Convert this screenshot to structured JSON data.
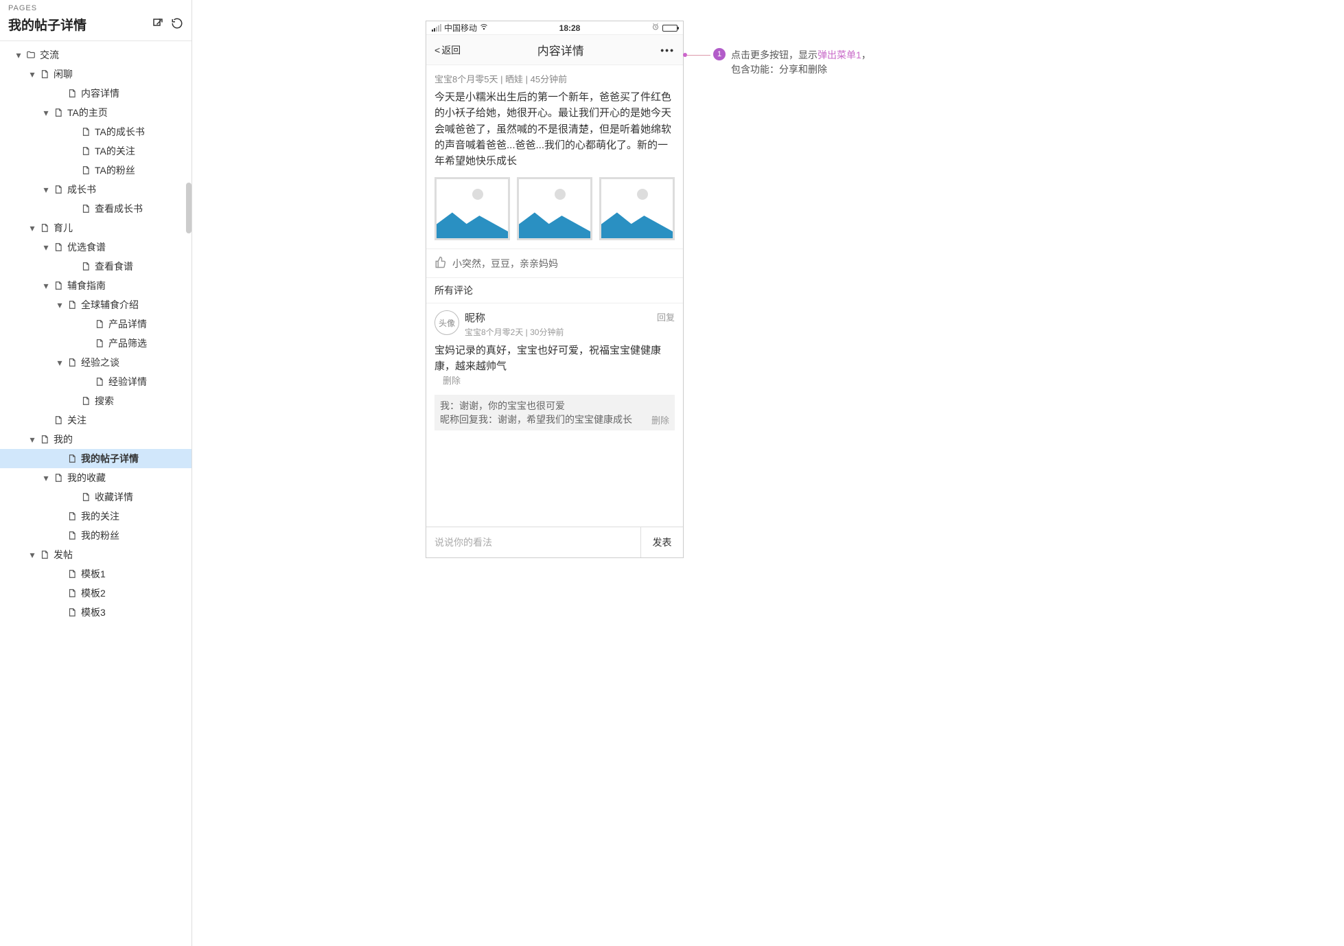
{
  "sidebar": {
    "pages_label": "PAGES",
    "title": "我的帖子详情",
    "tree": [
      {
        "pad": 20,
        "arrow": true,
        "icon": "folder",
        "label": "交流"
      },
      {
        "pad": 40,
        "arrow": true,
        "icon": "page",
        "label": "闲聊"
      },
      {
        "pad": 80,
        "arrow": false,
        "icon": "page",
        "label": "内容详情"
      },
      {
        "pad": 60,
        "arrow": true,
        "icon": "page",
        "label": "TA的主页"
      },
      {
        "pad": 100,
        "arrow": false,
        "icon": "page",
        "label": "TA的成长书"
      },
      {
        "pad": 100,
        "arrow": false,
        "icon": "page",
        "label": "TA的关注"
      },
      {
        "pad": 100,
        "arrow": false,
        "icon": "page",
        "label": "TA的粉丝"
      },
      {
        "pad": 60,
        "arrow": true,
        "icon": "page",
        "label": "成长书"
      },
      {
        "pad": 100,
        "arrow": false,
        "icon": "page",
        "label": "查看成长书"
      },
      {
        "pad": 40,
        "arrow": true,
        "icon": "page",
        "label": "育儿"
      },
      {
        "pad": 60,
        "arrow": true,
        "icon": "page",
        "label": "优选食谱"
      },
      {
        "pad": 100,
        "arrow": false,
        "icon": "page",
        "label": "查看食谱"
      },
      {
        "pad": 60,
        "arrow": true,
        "icon": "page",
        "label": "辅食指南"
      },
      {
        "pad": 80,
        "arrow": true,
        "icon": "page",
        "label": "全球辅食介绍"
      },
      {
        "pad": 120,
        "arrow": false,
        "icon": "page",
        "label": "产品详情"
      },
      {
        "pad": 120,
        "arrow": false,
        "icon": "page",
        "label": "产品筛选"
      },
      {
        "pad": 80,
        "arrow": true,
        "icon": "page",
        "label": "经验之谈"
      },
      {
        "pad": 120,
        "arrow": false,
        "icon": "page",
        "label": "经验详情"
      },
      {
        "pad": 100,
        "arrow": false,
        "icon": "page",
        "label": "搜索"
      },
      {
        "pad": 60,
        "arrow": false,
        "icon": "page",
        "label": "关注"
      },
      {
        "pad": 40,
        "arrow": true,
        "icon": "page",
        "label": "我的"
      },
      {
        "pad": 80,
        "arrow": false,
        "icon": "page",
        "label": "我的帖子详情",
        "selected": true
      },
      {
        "pad": 60,
        "arrow": true,
        "icon": "page",
        "label": "我的收藏"
      },
      {
        "pad": 100,
        "arrow": false,
        "icon": "page",
        "label": "收藏详情"
      },
      {
        "pad": 80,
        "arrow": false,
        "icon": "page",
        "label": "我的关注"
      },
      {
        "pad": 80,
        "arrow": false,
        "icon": "page",
        "label": "我的粉丝"
      },
      {
        "pad": 40,
        "arrow": true,
        "icon": "page",
        "label": "发帖"
      },
      {
        "pad": 80,
        "arrow": false,
        "icon": "page",
        "label": "模板1"
      },
      {
        "pad": 80,
        "arrow": false,
        "icon": "page",
        "label": "模板2"
      },
      {
        "pad": 80,
        "arrow": false,
        "icon": "page",
        "label": "模板3"
      }
    ]
  },
  "phone": {
    "status": {
      "carrier": "中国移动",
      "time": "18:28"
    },
    "nav": {
      "back": "返回",
      "title": "内容详情",
      "more": "•••"
    },
    "post": {
      "meta": "宝宝8个月零5天 |  晒娃  |  45分钟前",
      "body": "今天是小糯米出生后的第一个新年，爸爸买了件红色的小袄子给她，她很开心。最让我们开心的是她今天会喊爸爸了，虽然喊的不是很清楚，但是听着她绵软的声音喊着爸爸...爸爸...我们的心都萌化了。新的一年希望她快乐成长"
    },
    "likes": "小突然，豆豆，亲亲妈妈",
    "comments_header": "所有评论",
    "comment": {
      "avatar": "头像",
      "name": "昵称",
      "sub": "宝宝8个月零2天 |  30分钟前",
      "reply": "回复",
      "body": "宝妈记录的真好，宝宝也好可爱，祝福宝宝健健康康，越来越帅气",
      "delete": "删除"
    },
    "replies": {
      "r1": "我：谢谢，你的宝宝也很可爱",
      "r2": "昵称回复我：谢谢，希望我们的宝宝健康成长",
      "delete": "删除"
    },
    "input": {
      "placeholder": "说说你的看法",
      "send": "发表"
    }
  },
  "annotation": {
    "num": "1",
    "t1": "点击更多按钮，显示",
    "link": "弹出菜单1",
    "t2": "，包含功能：分享和删除"
  }
}
